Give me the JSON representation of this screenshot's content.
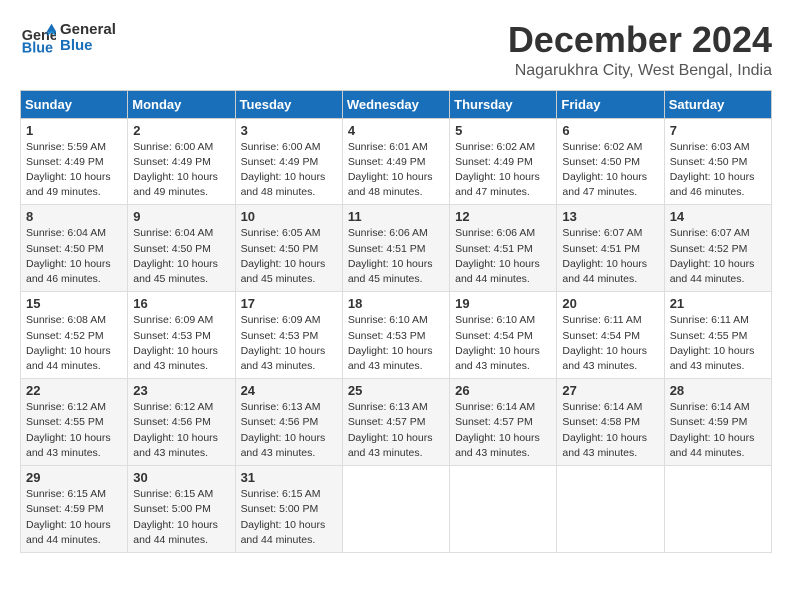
{
  "header": {
    "logo_line1": "General",
    "logo_line2": "Blue",
    "month": "December 2024",
    "location": "Nagarukhra City, West Bengal, India"
  },
  "weekdays": [
    "Sunday",
    "Monday",
    "Tuesday",
    "Wednesday",
    "Thursday",
    "Friday",
    "Saturday"
  ],
  "weeks": [
    [
      {
        "day": "1",
        "sunrise": "5:59 AM",
        "sunset": "4:49 PM",
        "daylight": "10 hours and 49 minutes."
      },
      {
        "day": "2",
        "sunrise": "6:00 AM",
        "sunset": "4:49 PM",
        "daylight": "10 hours and 49 minutes."
      },
      {
        "day": "3",
        "sunrise": "6:00 AM",
        "sunset": "4:49 PM",
        "daylight": "10 hours and 48 minutes."
      },
      {
        "day": "4",
        "sunrise": "6:01 AM",
        "sunset": "4:49 PM",
        "daylight": "10 hours and 48 minutes."
      },
      {
        "day": "5",
        "sunrise": "6:02 AM",
        "sunset": "4:49 PM",
        "daylight": "10 hours and 47 minutes."
      },
      {
        "day": "6",
        "sunrise": "6:02 AM",
        "sunset": "4:50 PM",
        "daylight": "10 hours and 47 minutes."
      },
      {
        "day": "7",
        "sunrise": "6:03 AM",
        "sunset": "4:50 PM",
        "daylight": "10 hours and 46 minutes."
      }
    ],
    [
      {
        "day": "8",
        "sunrise": "6:04 AM",
        "sunset": "4:50 PM",
        "daylight": "10 hours and 46 minutes."
      },
      {
        "day": "9",
        "sunrise": "6:04 AM",
        "sunset": "4:50 PM",
        "daylight": "10 hours and 45 minutes."
      },
      {
        "day": "10",
        "sunrise": "6:05 AM",
        "sunset": "4:50 PM",
        "daylight": "10 hours and 45 minutes."
      },
      {
        "day": "11",
        "sunrise": "6:06 AM",
        "sunset": "4:51 PM",
        "daylight": "10 hours and 45 minutes."
      },
      {
        "day": "12",
        "sunrise": "6:06 AM",
        "sunset": "4:51 PM",
        "daylight": "10 hours and 44 minutes."
      },
      {
        "day": "13",
        "sunrise": "6:07 AM",
        "sunset": "4:51 PM",
        "daylight": "10 hours and 44 minutes."
      },
      {
        "day": "14",
        "sunrise": "6:07 AM",
        "sunset": "4:52 PM",
        "daylight": "10 hours and 44 minutes."
      }
    ],
    [
      {
        "day": "15",
        "sunrise": "6:08 AM",
        "sunset": "4:52 PM",
        "daylight": "10 hours and 44 minutes."
      },
      {
        "day": "16",
        "sunrise": "6:09 AM",
        "sunset": "4:53 PM",
        "daylight": "10 hours and 43 minutes."
      },
      {
        "day": "17",
        "sunrise": "6:09 AM",
        "sunset": "4:53 PM",
        "daylight": "10 hours and 43 minutes."
      },
      {
        "day": "18",
        "sunrise": "6:10 AM",
        "sunset": "4:53 PM",
        "daylight": "10 hours and 43 minutes."
      },
      {
        "day": "19",
        "sunrise": "6:10 AM",
        "sunset": "4:54 PM",
        "daylight": "10 hours and 43 minutes."
      },
      {
        "day": "20",
        "sunrise": "6:11 AM",
        "sunset": "4:54 PM",
        "daylight": "10 hours and 43 minutes."
      },
      {
        "day": "21",
        "sunrise": "6:11 AM",
        "sunset": "4:55 PM",
        "daylight": "10 hours and 43 minutes."
      }
    ],
    [
      {
        "day": "22",
        "sunrise": "6:12 AM",
        "sunset": "4:55 PM",
        "daylight": "10 hours and 43 minutes."
      },
      {
        "day": "23",
        "sunrise": "6:12 AM",
        "sunset": "4:56 PM",
        "daylight": "10 hours and 43 minutes."
      },
      {
        "day": "24",
        "sunrise": "6:13 AM",
        "sunset": "4:56 PM",
        "daylight": "10 hours and 43 minutes."
      },
      {
        "day": "25",
        "sunrise": "6:13 AM",
        "sunset": "4:57 PM",
        "daylight": "10 hours and 43 minutes."
      },
      {
        "day": "26",
        "sunrise": "6:14 AM",
        "sunset": "4:57 PM",
        "daylight": "10 hours and 43 minutes."
      },
      {
        "day": "27",
        "sunrise": "6:14 AM",
        "sunset": "4:58 PM",
        "daylight": "10 hours and 43 minutes."
      },
      {
        "day": "28",
        "sunrise": "6:14 AM",
        "sunset": "4:59 PM",
        "daylight": "10 hours and 44 minutes."
      }
    ],
    [
      {
        "day": "29",
        "sunrise": "6:15 AM",
        "sunset": "4:59 PM",
        "daylight": "10 hours and 44 minutes."
      },
      {
        "day": "30",
        "sunrise": "6:15 AM",
        "sunset": "5:00 PM",
        "daylight": "10 hours and 44 minutes."
      },
      {
        "day": "31",
        "sunrise": "6:15 AM",
        "sunset": "5:00 PM",
        "daylight": "10 hours and 44 minutes."
      },
      null,
      null,
      null,
      null
    ]
  ]
}
